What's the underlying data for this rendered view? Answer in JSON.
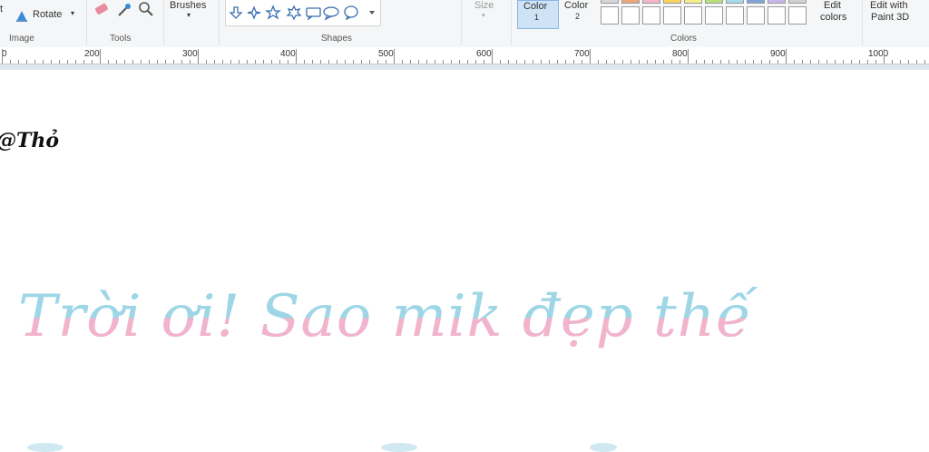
{
  "ribbon": {
    "image_group": {
      "rotate_label": "Rotate",
      "group_label": "Image"
    },
    "tools_group": {
      "group_label": "Tools"
    },
    "brushes_label": "Brushes",
    "shapes_group": {
      "group_label": "Shapes"
    },
    "size_label": "Size",
    "color1": {
      "line1": "Color",
      "line2": "1"
    },
    "color2": {
      "line1": "Color",
      "line2": "2"
    },
    "colors_group": {
      "group_label": "Colors"
    },
    "edit_colors": {
      "line1": "Edit",
      "line2": "colors"
    },
    "edit_paint3d": {
      "line1": "Edit with",
      "line2": "Paint 3D"
    },
    "palette_top_colors": [
      "#d6d6d6",
      "#e8a67a",
      "#f4b6c8",
      "#ffd35c",
      "#f6ee8a",
      "#b7e07a",
      "#a9d8ef",
      "#7fa3d6",
      "#c7b7e8",
      "#d0d0d0"
    ]
  },
  "ruler": {
    "labels": [
      "0",
      "200",
      "300",
      "400",
      "500",
      "600",
      "700",
      "800",
      "900",
      "1000"
    ]
  },
  "canvas": {
    "author_text": "@Thỏ",
    "main_text": "Trời ơi! Sao mik đẹp thế",
    "main_text_top_color": "#9ed6e6",
    "main_text_bottom_color": "#f3b3cc"
  }
}
